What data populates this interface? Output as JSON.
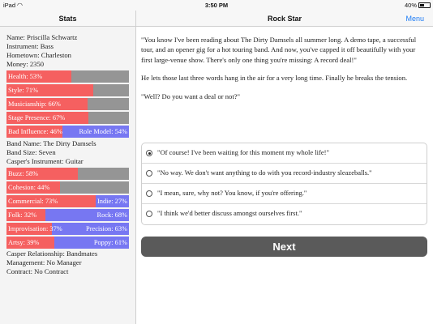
{
  "statusbar": {
    "carrier": "iPad",
    "time": "3:50 PM",
    "battery": "40%"
  },
  "left": {
    "title": "Stats",
    "info": [
      "Name: Priscilla Schwartz",
      "Instrument: Bass",
      "Hometown: Charleston",
      "Money: 2350"
    ],
    "bars1": [
      {
        "label": "Health: 53%",
        "value": 0.53
      },
      {
        "label": "Style: 71%",
        "value": 0.71
      },
      {
        "label": "Musicianship: 66%",
        "value": 0.66
      },
      {
        "label": "Stage Presence: 67%",
        "value": 0.67
      }
    ],
    "opposed1": {
      "left": "Bad Influence: 46%",
      "right": "Role Model: 54%",
      "value": 0.46
    },
    "band": [
      "Band Name: The Dirty Damsels",
      "Band Size: Seven",
      "Casper's Instrument: Guitar"
    ],
    "bars2": [
      {
        "label": "Buzz: 58%",
        "value": 0.58
      },
      {
        "label": "Cohesion: 44%",
        "value": 0.44
      }
    ],
    "opposed2": [
      {
        "left": "Commercial: 73%",
        "right": "Indie: 27%",
        "value": 0.73
      },
      {
        "left": "Folk: 32%",
        "right": "Rock: 68%",
        "value": 0.32
      },
      {
        "left": "Improvisation: 37%",
        "right": "Precision: 63%",
        "value": 0.37
      },
      {
        "left": "Artsy: 39%",
        "right": "Poppy: 61%",
        "value": 0.39
      }
    ],
    "footer": [
      "Casper Relationship: Bandmates",
      "Management: No Manager",
      "Contract: No Contract"
    ]
  },
  "right": {
    "title": "Rock Star",
    "menu": "Menu",
    "paragraphs": [
      "\"You know I've been reading about The Dirty Damsels all summer long. A demo tape, a successful tour, and an opener gig for a hot touring band. And now, you've capped it off beautifully with your first large-venue show. There's only one thing you're missing: A record deal!\"",
      "He lets those last three words hang in the air for a very long time. Finally he breaks the tension.",
      "\"Well? Do you want a deal or not?\""
    ],
    "choices": [
      "\"Of course! I've been waiting for this moment my whole life!\"",
      "\"No way. We don't want anything to do with you record-industry sleazeballs.\"",
      "\"I mean, sure, why not? You know, if you're offering.\"",
      "\"I think we'd better discuss amongst ourselves first.\""
    ],
    "selected": 0,
    "next": "Next"
  }
}
